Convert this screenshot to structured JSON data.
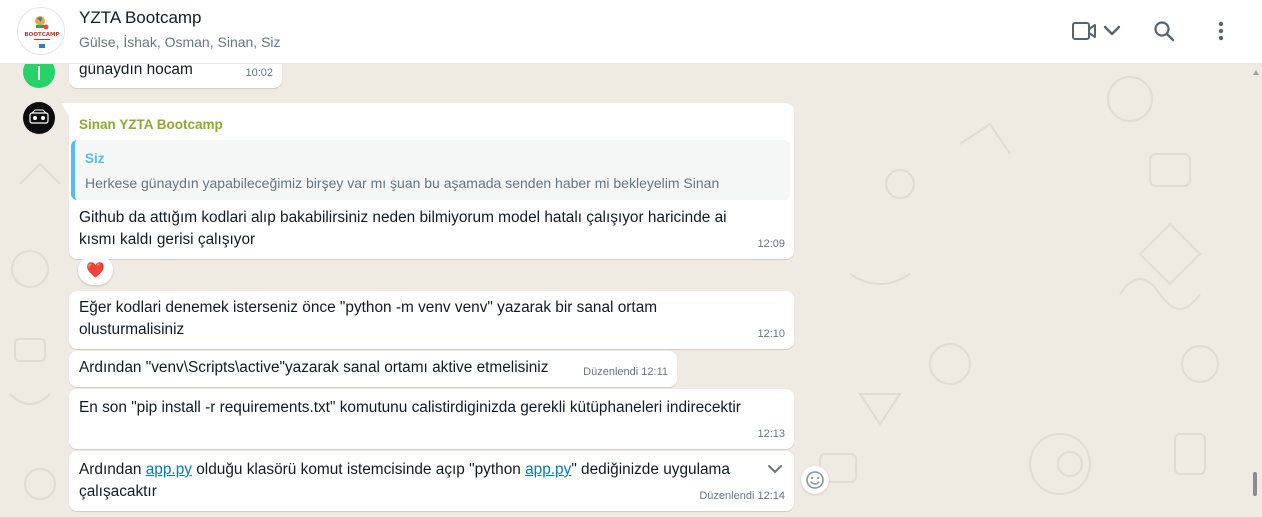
{
  "header": {
    "title": "YZTA Bootcamp",
    "participants": "Gülse, İshak, Osman, Sinan, Siz",
    "avatar_text": "BOOTCAMP"
  },
  "icons": {
    "video": "video-call-icon",
    "dropdown": "chevron-down-icon",
    "search": "search-icon",
    "menu": "menu-dots-icon"
  },
  "colors": {
    "accent_green": "#25d366",
    "sender_name": "#8bac2e",
    "quote_bar": "#53bdeb"
  },
  "messages": [
    {
      "text": "günaydın hocam",
      "time": "10:02"
    },
    {
      "sender": "Sinan YZTA Bootcamp",
      "quote": {
        "author": "Siz",
        "text": "Herkese günaydın yapabileceğimiz birşey var mı şuan bu aşamada senden haber mi bekleyelim Sinan"
      },
      "text_line1": "Github da attığım kodlari alıp bakabilirsiniz neden bilmiyorum model hatalı çalışıyor haricinde ai",
      "text_line2": "kısmı kaldı gerisi çalışıyor",
      "time": "12:09",
      "reaction": "❤️"
    },
    {
      "text_line1": "Eğer kodlari denemek isterseniz önce \"python -m venv venv\" yazarak bir sanal ortam",
      "text_line2": "olusturmalisiniz",
      "time": "12:10"
    },
    {
      "text": "Ardından \"venv\\Scripts\\active\"yazarak sanal ortamı aktive etmelisiniz",
      "edited": "Düzenlendi",
      "time": "12:11"
    },
    {
      "text": "En son \"pip install -r requirements.txt\" komutunu calistirdiginizda gerekli kütüphaneleri indirecektir",
      "time": "12:13"
    },
    {
      "part1": "Ardından ",
      "link1": "app.py",
      "part2": " olduğu klasörü komut istemcisinde açıp \"python ",
      "link2": "app.py",
      "part3": "\" dediğinizde uygulama",
      "text_line2": "çalışacaktır",
      "edited": "Düzenlendi",
      "time": "12:14"
    }
  ]
}
